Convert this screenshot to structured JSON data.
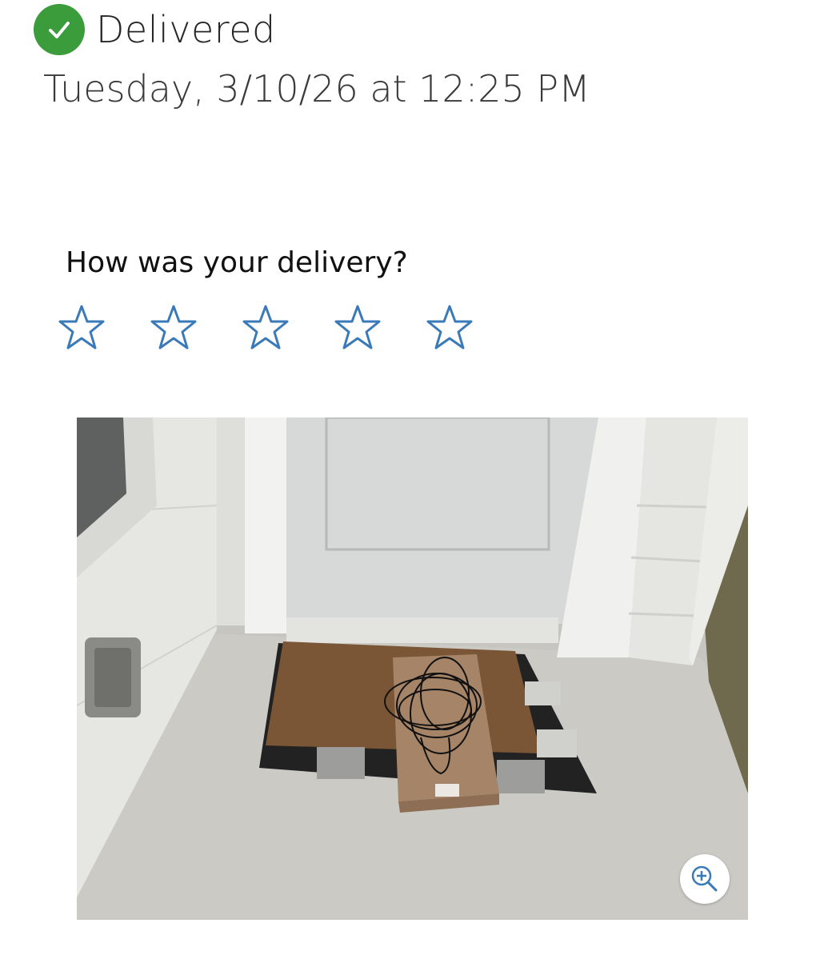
{
  "status": {
    "label": "Delivered",
    "icon": "check-circle-icon",
    "color": "#3a9c3a"
  },
  "delivery": {
    "timestamp": "Tuesday, 3/10/26 at 12:25 PM"
  },
  "rating": {
    "prompt": "How was your delivery?",
    "max_stars": 5,
    "selected": 0,
    "star_color": "#3a7ab8"
  },
  "photo": {
    "zoom_icon": "zoom-in-icon"
  }
}
